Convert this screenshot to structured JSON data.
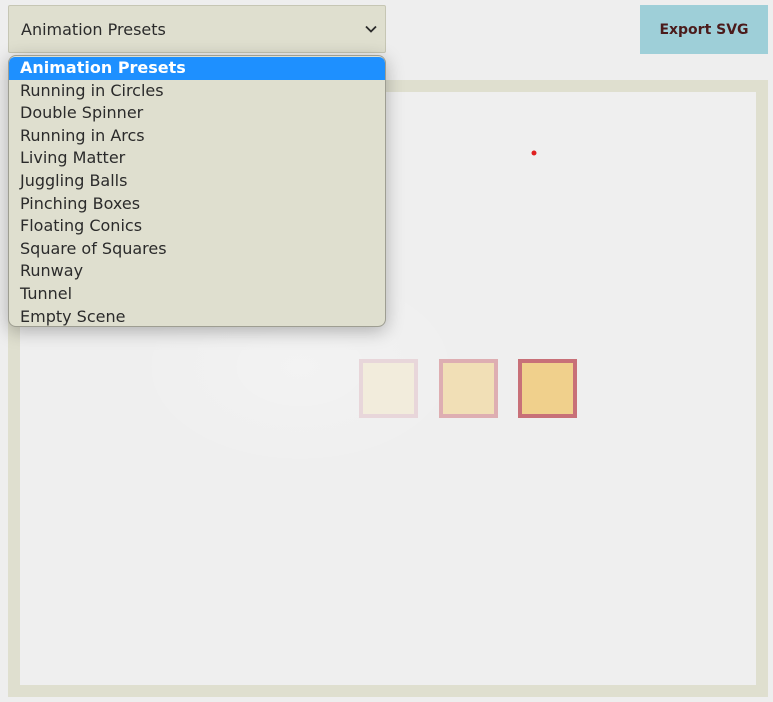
{
  "preset_select": {
    "selected_label": "Animation Presets",
    "options": [
      "Animation Presets",
      "Running in Circles",
      "Double Spinner",
      "Running in Arcs",
      "Living Matter",
      "Juggling Balls",
      "Pinching Boxes",
      "Floating Conics",
      "Square of Squares",
      "Runway",
      "Tunnel",
      "Empty Scene"
    ],
    "chevron_icon": "chevron-down-icon"
  },
  "toolbar": {
    "export_label": "Export SVG"
  },
  "colors": {
    "accent": "#1e90ff",
    "panel": "#dfdfcf",
    "export_button": "#9ecfd8",
    "dot": "#e02020",
    "box_fill": "#f0d08c",
    "box_stroke": "#c87078"
  }
}
